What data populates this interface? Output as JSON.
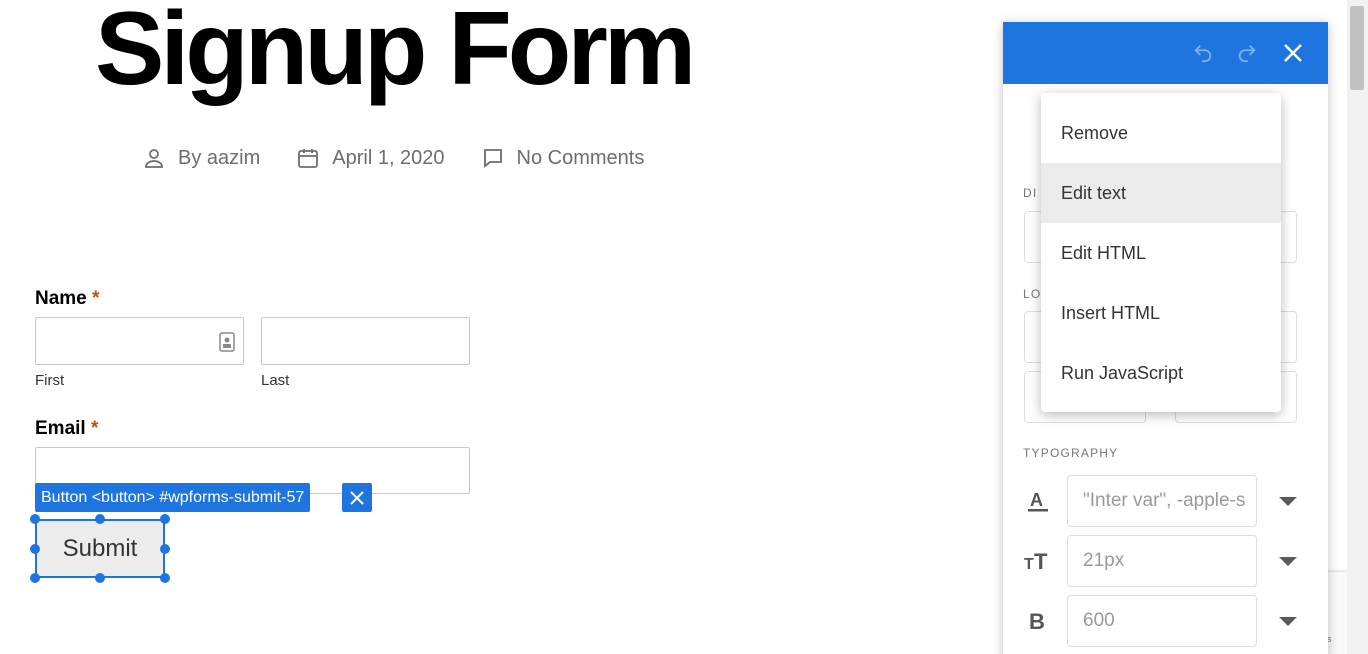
{
  "page": {
    "title": "Signup Form",
    "meta": {
      "author": "By aazim",
      "date": "April 1, 2020",
      "comments": "No Comments"
    }
  },
  "form": {
    "name_label": "Name",
    "required_mark": "*",
    "first_label": "First",
    "last_label": "Last",
    "email_label": "Email",
    "submit_label": "Submit"
  },
  "selection": {
    "tag": "Button <button> #wpforms-submit-57"
  },
  "panel": {
    "sections": {
      "dimensions_partial": "DI",
      "location_partial": "LO",
      "typography": "TYPOGRAPHY"
    },
    "font_family_placeholder": "\"Inter var\", -apple-s",
    "font_size_placeholder": "21px",
    "font_weight_placeholder": "600",
    "icons": [
      "undo-icon",
      "redo-icon",
      "close-icon",
      "font-color-icon",
      "text-size-icon",
      "bold-icon"
    ]
  },
  "context_menu": {
    "items": [
      {
        "label": "Remove"
      },
      {
        "label": "Edit text"
      },
      {
        "label": "Edit HTML"
      },
      {
        "label": "Insert HTML"
      },
      {
        "label": "Run JavaScript"
      }
    ],
    "active_index": 1
  },
  "recaptcha": {
    "text": "ns"
  },
  "colors": {
    "accent": "#1f75e0",
    "required": "#c94f00",
    "menu_highlight": "#ebebeb"
  }
}
